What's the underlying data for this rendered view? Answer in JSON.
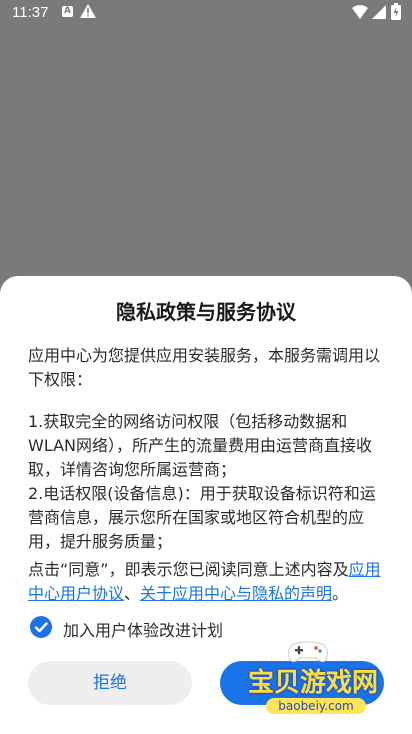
{
  "status_bar": {
    "time": "11:37",
    "icons": [
      "app-a-icon",
      "warning-icon",
      "wifi-icon",
      "signal-icon",
      "battery-icon"
    ]
  },
  "dialog": {
    "title": "隐私政策与服务协议",
    "paragraph1": "应用中心为您提供应用安装服务，本服务需调用以下权限：",
    "paragraph2_line1": "1.获取完全的网络访问权限（包括移动数据和WLAN网络），所产生的流量费用由运营商直接收取，详情咨询您所属运营商；",
    "paragraph2_line2": "2.电话权限(设备信息)：用于获取设备标识符和运营商信息，展示您所在国家或地区符合机型的应用，提升服务质量；",
    "consent_prefix": "点击“同意”，即表示您已阅读同意上述内容及",
    "link1": "应用中心用户协议",
    "separator": "、",
    "link2": "关于应用中心与隐私的声明",
    "consent_suffix": "。",
    "checkbox_label": "加入用户体验改进计划",
    "checkbox_checked": true,
    "reject_label": "拒绝",
    "agree_label": ""
  },
  "watermark": {
    "text": "宝贝游戏网",
    "url": "baobeiy.com"
  },
  "colors": {
    "accent": "#1a73e8",
    "scrim": "#7a7a7a",
    "sheet": "#ffffff"
  }
}
